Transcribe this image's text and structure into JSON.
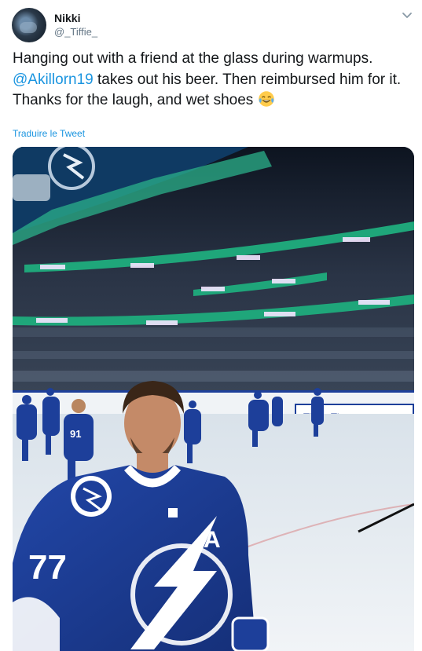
{
  "tweet": {
    "author": {
      "display_name": "Nikki",
      "handle": "@_Tiffie_"
    },
    "text_before_mention": "Hanging out with a friend at the glass during warmups. ",
    "mention": "@Akillorn19",
    "text_after_mention": " takes out his beer. Then reimbursed him for it. Thanks for the laugh, and wet shoes",
    "emoji": "face-with-tears-of-joy-emoji",
    "translate_link": "Traduire le Tweet",
    "menu_icon": "chevron-down-icon"
  },
  "media": {
    "alt_subject": "hockey-arena-warmup-photo",
    "jersey_letter": "A",
    "jersey_number_back": "91",
    "board_ads": [
      "Times Times",
      "Tampa Bay Times"
    ],
    "colors": {
      "jersey_blue": "#1d3f9a",
      "ice": "#e9eef3",
      "led_green": "#1fa67a",
      "link_blue": "#1b95e0"
    }
  }
}
